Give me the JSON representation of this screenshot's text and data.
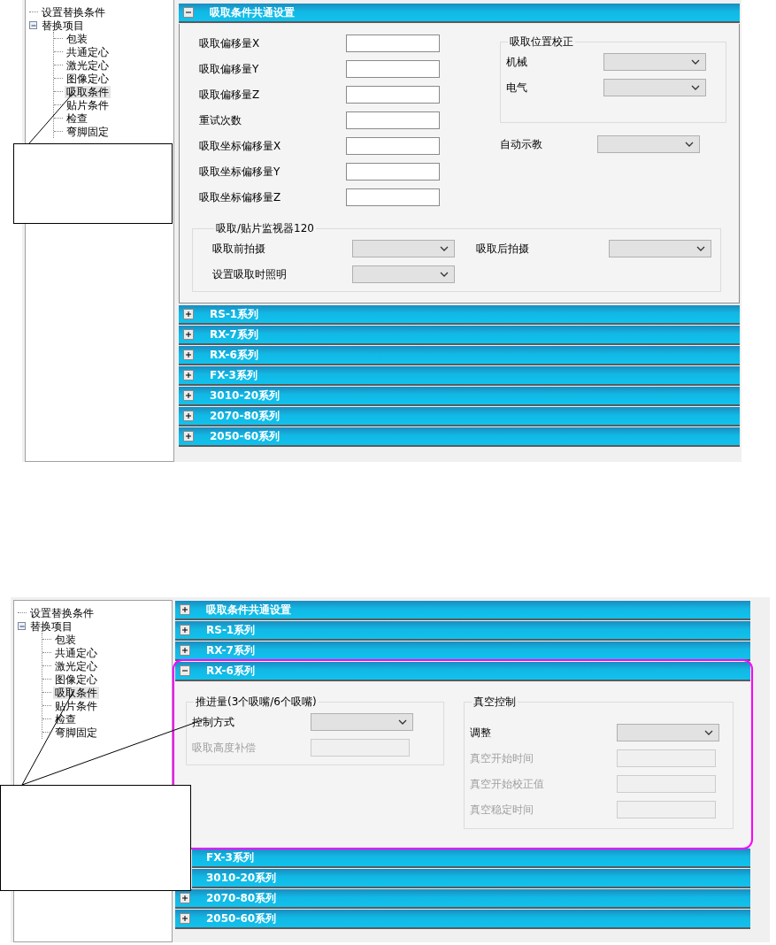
{
  "screens": [
    {
      "tree": {
        "items": [
          {
            "label": "设置替换条件",
            "selected": false
          },
          {
            "label": "替换项目",
            "selected": false,
            "expanded": true,
            "children": [
              {
                "label": "包装",
                "selected": false
              },
              {
                "label": "共通定心",
                "selected": false
              },
              {
                "label": "激光定心",
                "selected": false
              },
              {
                "label": "图像定心",
                "selected": false
              },
              {
                "label": "吸取条件",
                "selected": true
              },
              {
                "label": "贴片条件",
                "selected": false
              },
              {
                "label": "检查",
                "selected": false
              },
              {
                "label": "弯脚固定",
                "selected": false
              }
            ]
          }
        ]
      },
      "sections": [
        {
          "title": "吸取条件共通设置",
          "expanded": true,
          "highlighted": false,
          "content": {
            "columns": [
              [
                {
                  "kind": "text",
                  "label": "吸取偏移量X",
                  "disabled": false
                },
                {
                  "kind": "text",
                  "label": "吸取偏移量Y",
                  "disabled": false
                },
                {
                  "kind": "text",
                  "label": "吸取偏移量Z",
                  "disabled": false
                },
                {
                  "kind": "text",
                  "label": "重试次数",
                  "disabled": false
                },
                {
                  "kind": "text",
                  "label": "吸取坐标偏移量X",
                  "disabled": false
                },
                {
                  "kind": "text",
                  "label": "吸取坐标偏移量Y",
                  "disabled": false
                },
                {
                  "kind": "text",
                  "label": "吸取坐标偏移量Z",
                  "disabled": false
                }
              ],
              [
                {
                  "kind": "group",
                  "title": "吸取位置校正",
                  "columns": [
                    [
                      {
                        "kind": "select",
                        "label": "机械",
                        "disabled": false
                      },
                      {
                        "kind": "select",
                        "label": "电气",
                        "disabled": false
                      }
                    ]
                  ]
                },
                {
                  "kind": "select",
                  "label": "自动示教",
                  "disabled": false
                }
              ]
            ],
            "footer": [
              {
                "kind": "group",
                "title": "吸取/贴片监视器120",
                "columns": [
                  [
                    {
                      "kind": "select",
                      "label": "吸取前拍摄",
                      "disabled": false
                    },
                    {
                      "kind": "select",
                      "label": "设置吸取时照明",
                      "disabled": false
                    }
                  ],
                  [
                    {
                      "kind": "select",
                      "label": "吸取后拍摄",
                      "disabled": false
                    }
                  ]
                ]
              }
            ]
          }
        },
        {
          "title": "RS-1系列",
          "expanded": false,
          "highlighted": false
        },
        {
          "title": "RX-7系列",
          "expanded": false,
          "highlighted": false
        },
        {
          "title": "RX-6系列",
          "expanded": false,
          "highlighted": false
        },
        {
          "title": "FX-3系列",
          "expanded": false,
          "highlighted": false
        },
        {
          "title": "3010-20系列",
          "expanded": false,
          "highlighted": false
        },
        {
          "title": "2070-80系列",
          "expanded": false,
          "highlighted": false
        },
        {
          "title": "2050-60系列",
          "expanded": false,
          "highlighted": false
        }
      ]
    },
    {
      "tree": {
        "items": [
          {
            "label": "设置替换条件",
            "selected": false
          },
          {
            "label": "替换项目",
            "selected": false,
            "expanded": true,
            "children": [
              {
                "label": "包装",
                "selected": false
              },
              {
                "label": "共通定心",
                "selected": false
              },
              {
                "label": "激光定心",
                "selected": false
              },
              {
                "label": "图像定心",
                "selected": false
              },
              {
                "label": "吸取条件",
                "selected": true
              },
              {
                "label": "贴片条件",
                "selected": false
              },
              {
                "label": "检查",
                "selected": false
              },
              {
                "label": "弯脚固定",
                "selected": false
              }
            ]
          }
        ]
      },
      "sections": [
        {
          "title": "吸取条件共通设置",
          "expanded": false,
          "highlighted": false
        },
        {
          "title": "RS-1系列",
          "expanded": false,
          "highlighted": false
        },
        {
          "title": "RX-7系列",
          "expanded": false,
          "highlighted": false
        },
        {
          "title": "RX-6系列",
          "expanded": true,
          "highlighted": true,
          "content": {
            "columns": [
              [
                {
                  "kind": "group",
                  "title": "推进量(3个吸嘴/6个吸嘴)",
                  "columns": [
                    [
                      {
                        "kind": "select",
                        "label": "控制方式",
                        "disabled": false
                      },
                      {
                        "kind": "text",
                        "label": "吸取高度补偿",
                        "disabled": true
                      }
                    ]
                  ]
                }
              ],
              [
                {
                  "kind": "group",
                  "title": "真空控制",
                  "columns": [
                    [
                      {
                        "kind": "select",
                        "label": "调整",
                        "disabled": false
                      },
                      {
                        "kind": "text",
                        "label": "真空开始时间",
                        "disabled": true
                      },
                      {
                        "kind": "text",
                        "label": "真空开始校正值",
                        "disabled": true
                      },
                      {
                        "kind": "text",
                        "label": "真空稳定时间",
                        "disabled": true
                      }
                    ]
                  ]
                }
              ]
            ]
          }
        },
        {
          "title": "FX-3系列",
          "highlighted": false
        },
        {
          "title": "3010-20系列",
          "highlighted": false
        },
        {
          "title": "2070-80系列",
          "expanded": false,
          "highlighted": false
        },
        {
          "title": "2050-60系列",
          "expanded": false,
          "highlighted": false
        }
      ]
    }
  ]
}
